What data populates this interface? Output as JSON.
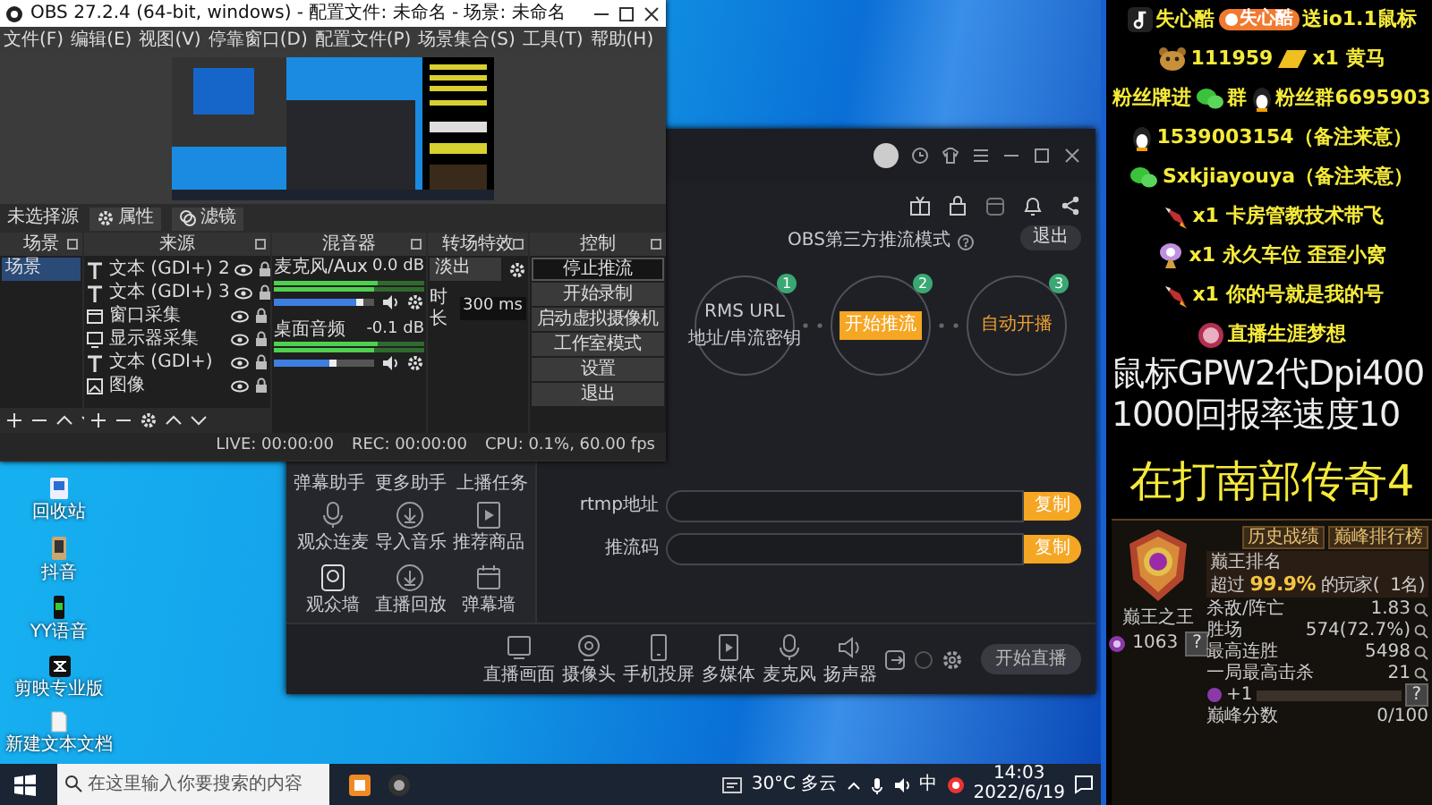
{
  "obs_window": {
    "title": "OBS 27.2.4 (64-bit, windows) - 配置文件: 未命名 - 场景: 未命名",
    "menu": [
      "文件(F)",
      "编辑(E)",
      "视图(V)",
      "停靠窗口(D)",
      "配置文件(P)",
      "场景集合(S)",
      "工具(T)",
      "帮助(H)"
    ],
    "source_toolbar": {
      "label": "未选择源",
      "buttons": [
        "属性",
        "滤镜"
      ]
    },
    "docks": {
      "scenes": {
        "title": "场景",
        "items": [
          {
            "label": "场景",
            "selected": true
          }
        ]
      },
      "sources": {
        "title": "来源",
        "items": [
          {
            "kind": "text",
            "label": "文本 (GDI+) 2"
          },
          {
            "kind": "text",
            "label": "文本 (GDI+) 3"
          },
          {
            "kind": "window",
            "label": "窗口采集"
          },
          {
            "kind": "display",
            "label": "显示器采集"
          },
          {
            "kind": "text",
            "label": "文本 (GDI+)"
          },
          {
            "kind": "image",
            "label": "图像"
          }
        ]
      },
      "mixer": {
        "title": "混音器",
        "channels": [
          {
            "name": "麦克风/Aux",
            "reading": "0.0 dB",
            "level": 0.9
          },
          {
            "name": "桌面音频",
            "reading": "-0.1 dB",
            "level": 0.62
          }
        ]
      },
      "transitions": {
        "title": "转场特效",
        "type": "淡出",
        "duration_label": "时长",
        "duration": "300 ms"
      },
      "controls": {
        "title": "控制",
        "buttons": [
          {
            "label": "停止推流",
            "active": true
          },
          {
            "label": "开始录制",
            "active": false
          },
          {
            "label": "启动虚拟摄像机",
            "active": false
          },
          {
            "label": "工作室模式",
            "active": false
          },
          {
            "label": "设置",
            "active": false
          },
          {
            "label": "退出",
            "active": false
          }
        ]
      }
    },
    "status_bar": [
      "LIVE: 00:00:00",
      "REC: 00:00:00",
      "CPU: 0.1%, 60.00 fps"
    ]
  },
  "streaming_app": {
    "mode_title": "OBS第三方推流模式",
    "exit_button": "退出",
    "steps": [
      {
        "kind": "text",
        "number": "1",
        "texts": [
          "RMS URL",
          "地址/串流密钥"
        ]
      },
      {
        "kind": "button",
        "number": "2",
        "texts": [
          "开始推流"
        ]
      },
      {
        "kind": "text",
        "number": "3",
        "texts": [
          "自动开播"
        ]
      }
    ],
    "fields": [
      {
        "label": "rtmp地址",
        "button": "复制"
      },
      {
        "label": "推流码",
        "button": "复制"
      }
    ],
    "sidebar_tabs": [
      "弹幕助手",
      "更多助手",
      "上播任务"
    ],
    "sidebar_tools": [
      "观众连麦",
      "导入音乐",
      "推荐商品",
      "观众墙",
      "直播回放",
      "弹幕墙"
    ],
    "toolbar": [
      "直播画面",
      "摄像头",
      "手机投屏",
      "多媒体",
      "麦克风",
      "扬声器"
    ],
    "start_button": "开始直播"
  },
  "desktop_icons": [
    {
      "label": "回收站"
    },
    {
      "label": "抖音"
    },
    {
      "label": "YY语音"
    },
    {
      "label": "剪映专业版"
    },
    {
      "label": "新建文本文档"
    }
  ],
  "taskbar": {
    "search_placeholder": "在这里输入你要搜索的内容",
    "weather": "30°C 多云",
    "ime": "中",
    "time": "14:03",
    "date": "2022/6/19"
  },
  "overlay": {
    "lines": [
      [
        "失心酷",
        "失心酷",
        "送io1.1鼠标"
      ],
      [
        "111959",
        "x1 黄马"
      ],
      [
        "粉丝牌进",
        "群",
        "粉丝群6695903"
      ],
      [
        "1539003154（备注来意）"
      ],
      [
        "Sxkjiayouya（备注来意）"
      ],
      [
        "x1 卡房管教技术带飞"
      ],
      [
        "x1 永久车位 歪歪小窝"
      ],
      [
        "x1 你的号就是我的号"
      ],
      [
        "直播生涯梦想"
      ]
    ],
    "big_lines": [
      "鼠标GPW2代Dpi400",
      "1000回报率速度10"
    ],
    "highlight": "在打南部传奇4",
    "game_card": {
      "buttons": [
        "历史战绩",
        "巅峰排行榜"
      ],
      "rank_title": "巅王排名",
      "rank_line": "超过 **99.9%** 的玩家(",
      "rank_count": "1名)",
      "stats": [
        [
          "杀敌/阵亡",
          "1.83"
        ],
        [
          "胜场",
          "574(72.7%)"
        ],
        [
          "最高连胜",
          "5498"
        ],
        [
          "一局最高击杀",
          "21"
        ]
      ],
      "rank_name": "巅王之王",
      "score": "1063",
      "help": "?",
      "progress_label": "+1",
      "progress": {
        "level": 0
      },
      "progress_help": "?",
      "footer_label": "巅峰分数",
      "footer_value": "0/100"
    }
  }
}
